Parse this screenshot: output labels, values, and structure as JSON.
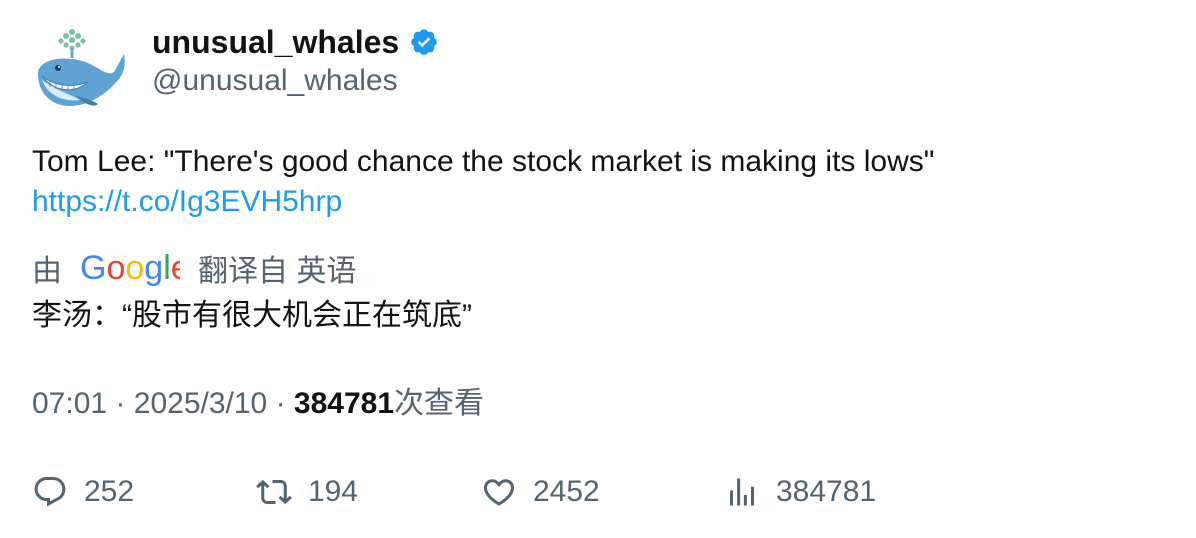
{
  "author": {
    "display_name": "unusual_whales",
    "handle": "@unusual_whales",
    "verified": true,
    "verified_color": "#1d9bf0"
  },
  "tweet": {
    "text": "Tom Lee: \"There's good chance the stock market is making its lows\"",
    "link": "https://t.co/Ig3EVH5hrp",
    "link_color": "#1d9bf0"
  },
  "translation": {
    "prefix": "由",
    "provider": "Google",
    "suffix": "翻译自 英语",
    "translated_text": "李汤：“股市有很大机会正在筑底”"
  },
  "meta": {
    "time": "07:01",
    "separator": "·",
    "date": "2025/3/10",
    "views_count": "384781",
    "views_label": "次查看"
  },
  "actions": {
    "replies": {
      "icon": "reply-icon",
      "count": "252"
    },
    "retweets": {
      "icon": "retweet-icon",
      "count": "194"
    },
    "likes": {
      "icon": "heart-icon",
      "count": "2452"
    },
    "views": {
      "icon": "analytics-icon",
      "count": "384781"
    }
  },
  "colors": {
    "text_primary": "#0f1419",
    "text_secondary": "#536471",
    "accent": "#1d9bf0"
  }
}
